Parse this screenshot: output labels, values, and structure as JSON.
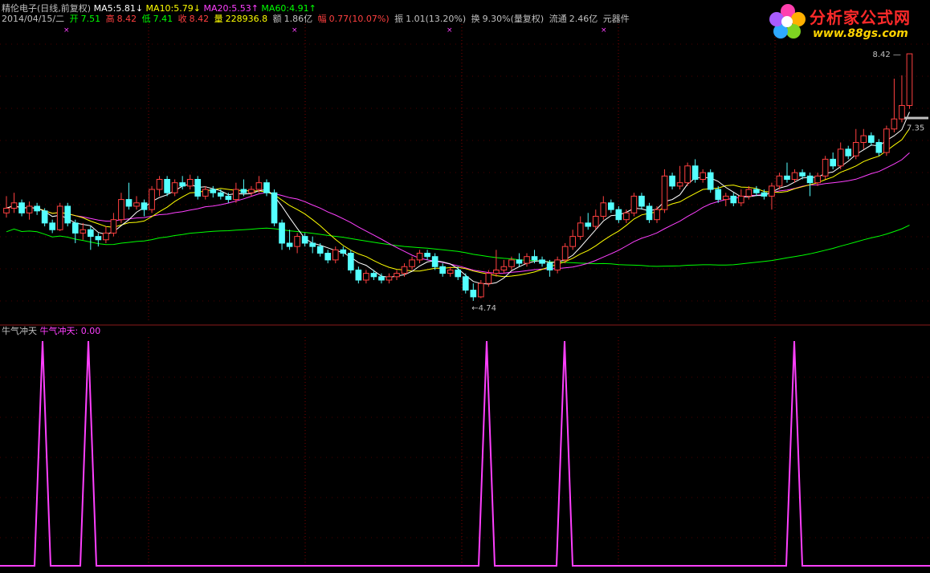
{
  "header": {
    "name": "精伦电子",
    "mode": "(日线,前复权)",
    "ma5_label": "MA5:",
    "ma5_value": "5.81↓",
    "ma10_label": "MA10:",
    "ma10_value": "5.79↓",
    "ma20_label": "MA20:",
    "ma20_value": "5.53↑",
    "ma60_label": "MA60:",
    "ma60_value": "4.91↑",
    "date": "2014/04/15/二",
    "open_label": "开",
    "open_value": "7.51",
    "high_label": "高",
    "high_value": "8.42",
    "low_label": "低",
    "low_value": "7.41",
    "close_label": "收",
    "close_value": "8.42",
    "volume_label": "量",
    "volume_value": "228936.8",
    "amount_label": "额",
    "amount_value": "1.86亿",
    "change_label": "幅",
    "change_value": "0.77(10.07%)",
    "amplitude_label": "振",
    "amplitude_value": "1.01(13.20%)",
    "turnover_label": "换",
    "turnover_value": "9.30%(量复权)",
    "float_label": "流通",
    "float_value": "2.46亿",
    "sector": "元器件"
  },
  "indicator_header": {
    "name": "牛气冲天",
    "series_label": "牛气冲天:",
    "series_value": "0.00"
  },
  "logo": {
    "title": "分析家公式网",
    "url": "www.88gs.com"
  },
  "colors": {
    "up": "#ff4040",
    "down": "#54ffff",
    "ma5": "#ffffff",
    "ma10": "#ffff00",
    "ma20": "#ff40ff",
    "ma60": "#00ff00",
    "indicator": "#ff40ff",
    "grid": "#800000",
    "text": "#c0c0c0",
    "label_green": "#00ff00"
  },
  "chart_data": [
    {
      "type": "candlestick",
      "title": "",
      "ylim": [
        4.5,
        8.6
      ],
      "annotations": [
        {
          "label": "8.42",
          "value": 8.42
        },
        {
          "label": "4.74",
          "value": 4.74
        },
        {
          "label": "7.35",
          "value": 7.35
        }
      ],
      "candles": [
        [
          6.05,
          6.12,
          6.3,
          5.98
        ],
        [
          6.12,
          6.2,
          6.35,
          6.05
        ],
        [
          6.2,
          6.05,
          6.25,
          6.0
        ],
        [
          6.05,
          6.15,
          6.22,
          5.95
        ],
        [
          6.15,
          6.08,
          6.2,
          6.02
        ],
        [
          6.08,
          5.9,
          6.12,
          5.85
        ],
        [
          5.9,
          5.8,
          5.95,
          5.75
        ],
        [
          5.8,
          6.15,
          6.2,
          5.78
        ],
        [
          6.15,
          5.9,
          6.2,
          5.85
        ],
        [
          5.9,
          5.75,
          5.95,
          5.6
        ],
        [
          5.75,
          5.8,
          5.9,
          5.65
        ],
        [
          5.8,
          5.7,
          5.85,
          5.5
        ],
        [
          5.7,
          5.65,
          5.75,
          5.55
        ],
        [
          5.65,
          5.75,
          5.85,
          5.6
        ],
        [
          5.75,
          5.95,
          6.05,
          5.7
        ],
        [
          5.95,
          6.25,
          6.35,
          5.9
        ],
        [
          6.25,
          6.15,
          6.5,
          6.1
        ],
        [
          6.15,
          6.2,
          6.3,
          6.1
        ],
        [
          6.2,
          6.1,
          6.25,
          6.0
        ],
        [
          6.1,
          6.4,
          6.45,
          6.05
        ],
        [
          6.4,
          6.55,
          6.6,
          6.3
        ],
        [
          6.55,
          6.35,
          6.6,
          6.3
        ],
        [
          6.35,
          6.5,
          6.55,
          6.3
        ],
        [
          6.5,
          6.45,
          6.6,
          6.4
        ],
        [
          6.45,
          6.55,
          6.62,
          6.4
        ],
        [
          6.55,
          6.3,
          6.6,
          6.25
        ],
        [
          6.3,
          6.4,
          6.45,
          6.25
        ],
        [
          6.4,
          6.35,
          6.45,
          6.28
        ],
        [
          6.35,
          6.3,
          6.4,
          6.25
        ],
        [
          6.3,
          6.25,
          6.35,
          6.2
        ],
        [
          6.25,
          6.4,
          6.5,
          6.2
        ],
        [
          6.4,
          6.35,
          6.55,
          6.3
        ],
        [
          6.35,
          6.4,
          6.45,
          6.3
        ],
        [
          6.4,
          6.5,
          6.6,
          6.35
        ],
        [
          6.5,
          6.35,
          6.55,
          6.3
        ],
        [
          6.35,
          5.9,
          6.4,
          5.85
        ],
        [
          5.9,
          5.6,
          5.95,
          5.5
        ],
        [
          5.6,
          5.55,
          5.8,
          5.5
        ],
        [
          5.55,
          5.7,
          5.75,
          5.45
        ],
        [
          5.7,
          5.6,
          5.75,
          5.55
        ],
        [
          5.6,
          5.55,
          5.7,
          5.45
        ],
        [
          5.55,
          5.45,
          5.6,
          5.4
        ],
        [
          5.45,
          5.35,
          5.5,
          5.3
        ],
        [
          5.35,
          5.5,
          5.55,
          5.3
        ],
        [
          5.5,
          5.45,
          5.55,
          5.4
        ],
        [
          5.45,
          5.2,
          5.5,
          5.15
        ],
        [
          5.2,
          5.05,
          5.25,
          5.0
        ],
        [
          5.05,
          5.15,
          5.2,
          5.0
        ],
        [
          5.15,
          5.1,
          5.2,
          5.05
        ],
        [
          5.1,
          5.05,
          5.15,
          5.0
        ],
        [
          5.05,
          5.1,
          5.15,
          5.0
        ],
        [
          5.1,
          5.15,
          5.2,
          5.05
        ],
        [
          5.15,
          5.25,
          5.3,
          5.1
        ],
        [
          5.25,
          5.35,
          5.4,
          5.2
        ],
        [
          5.35,
          5.45,
          5.5,
          5.3
        ],
        [
          5.45,
          5.4,
          5.5,
          5.35
        ],
        [
          5.4,
          5.25,
          5.45,
          5.2
        ],
        [
          5.25,
          5.15,
          5.3,
          5.1
        ],
        [
          5.15,
          5.2,
          5.25,
          5.1
        ],
        [
          5.2,
          5.1,
          5.25,
          5.05
        ],
        [
          5.1,
          4.9,
          5.15,
          4.85
        ],
        [
          4.9,
          4.8,
          5.0,
          4.74
        ],
        [
          4.8,
          5.0,
          5.05,
          4.78
        ],
        [
          5.0,
          5.15,
          5.2,
          4.95
        ],
        [
          5.15,
          5.2,
          5.5,
          5.1
        ],
        [
          5.2,
          5.25,
          5.35,
          5.15
        ],
        [
          5.25,
          5.35,
          5.4,
          5.2
        ],
        [
          5.35,
          5.3,
          5.45,
          5.25
        ],
        [
          5.3,
          5.4,
          5.45,
          5.25
        ],
        [
          5.4,
          5.35,
          5.5,
          5.3
        ],
        [
          5.35,
          5.3,
          5.4,
          5.25
        ],
        [
          5.3,
          5.2,
          5.35,
          5.1
        ],
        [
          5.2,
          5.35,
          5.4,
          5.15
        ],
        [
          5.35,
          5.55,
          5.6,
          5.3
        ],
        [
          5.55,
          5.7,
          5.8,
          5.5
        ],
        [
          5.7,
          5.9,
          6.0,
          5.65
        ],
        [
          5.9,
          5.85,
          6.05,
          5.8
        ],
        [
          5.85,
          6.0,
          6.1,
          5.8
        ],
        [
          6.0,
          6.2,
          6.3,
          5.95
        ],
        [
          6.2,
          6.1,
          6.25,
          6.05
        ],
        [
          6.1,
          5.95,
          6.15,
          5.9
        ],
        [
          5.95,
          6.05,
          6.1,
          5.9
        ],
        [
          6.05,
          6.3,
          6.35,
          6.0
        ],
        [
          6.3,
          6.15,
          6.35,
          6.1
        ],
        [
          6.15,
          5.95,
          6.2,
          5.9
        ],
        [
          5.95,
          6.1,
          6.15,
          5.9
        ],
        [
          6.1,
          6.6,
          6.7,
          6.05
        ],
        [
          6.6,
          6.45,
          6.65,
          6.4
        ],
        [
          6.45,
          6.5,
          6.75,
          6.4
        ],
        [
          6.5,
          6.75,
          6.8,
          6.45
        ],
        [
          6.75,
          6.55,
          6.85,
          6.5
        ],
        [
          6.55,
          6.65,
          6.7,
          6.5
        ],
        [
          6.65,
          6.4,
          6.7,
          6.35
        ],
        [
          6.4,
          6.25,
          6.45,
          6.2
        ],
        [
          6.25,
          6.3,
          6.35,
          6.15
        ],
        [
          6.3,
          6.2,
          6.35,
          6.15
        ],
        [
          6.2,
          6.3,
          6.4,
          6.15
        ],
        [
          6.3,
          6.4,
          6.45,
          6.25
        ],
        [
          6.4,
          6.35,
          6.45,
          6.3
        ],
        [
          6.35,
          6.3,
          6.4,
          6.25
        ],
        [
          6.3,
          6.45,
          6.5,
          6.1
        ],
        [
          6.45,
          6.6,
          6.65,
          6.4
        ],
        [
          6.6,
          6.55,
          6.8,
          6.5
        ],
        [
          6.55,
          6.65,
          6.7,
          6.5
        ],
        [
          6.65,
          6.6,
          6.7,
          6.55
        ],
        [
          6.6,
          6.5,
          6.65,
          6.3
        ],
        [
          6.5,
          6.6,
          6.65,
          6.45
        ],
        [
          6.6,
          6.85,
          6.9,
          6.55
        ],
        [
          6.85,
          6.75,
          6.95,
          6.7
        ],
        [
          6.75,
          7.0,
          7.1,
          6.7
        ],
        [
          7.0,
          6.9,
          7.05,
          6.85
        ],
        [
          6.9,
          7.1,
          7.3,
          6.85
        ],
        [
          7.1,
          7.2,
          7.3,
          7.0
        ],
        [
          7.2,
          7.1,
          7.25,
          7.05
        ],
        [
          7.1,
          6.95,
          7.15,
          6.9
        ],
        [
          6.95,
          7.3,
          7.35,
          6.9
        ],
        [
          7.3,
          7.45,
          8.05,
          7.25
        ],
        [
          7.45,
          7.65,
          8.1,
          7.4
        ],
        [
          7.65,
          8.42,
          8.42,
          7.6
        ]
      ],
      "ma": {
        "ma5": "white",
        "ma10": "yellow",
        "ma20": "magenta",
        "ma60": "green"
      }
    },
    {
      "type": "line",
      "title": "",
      "ylim": [
        0,
        1
      ],
      "spikes_at_index": [
        7,
        15,
        89,
        102,
        145
      ],
      "series": [
        {
          "name": "牛气冲天",
          "values": "0 except 1.0 at spikes"
        }
      ]
    }
  ]
}
